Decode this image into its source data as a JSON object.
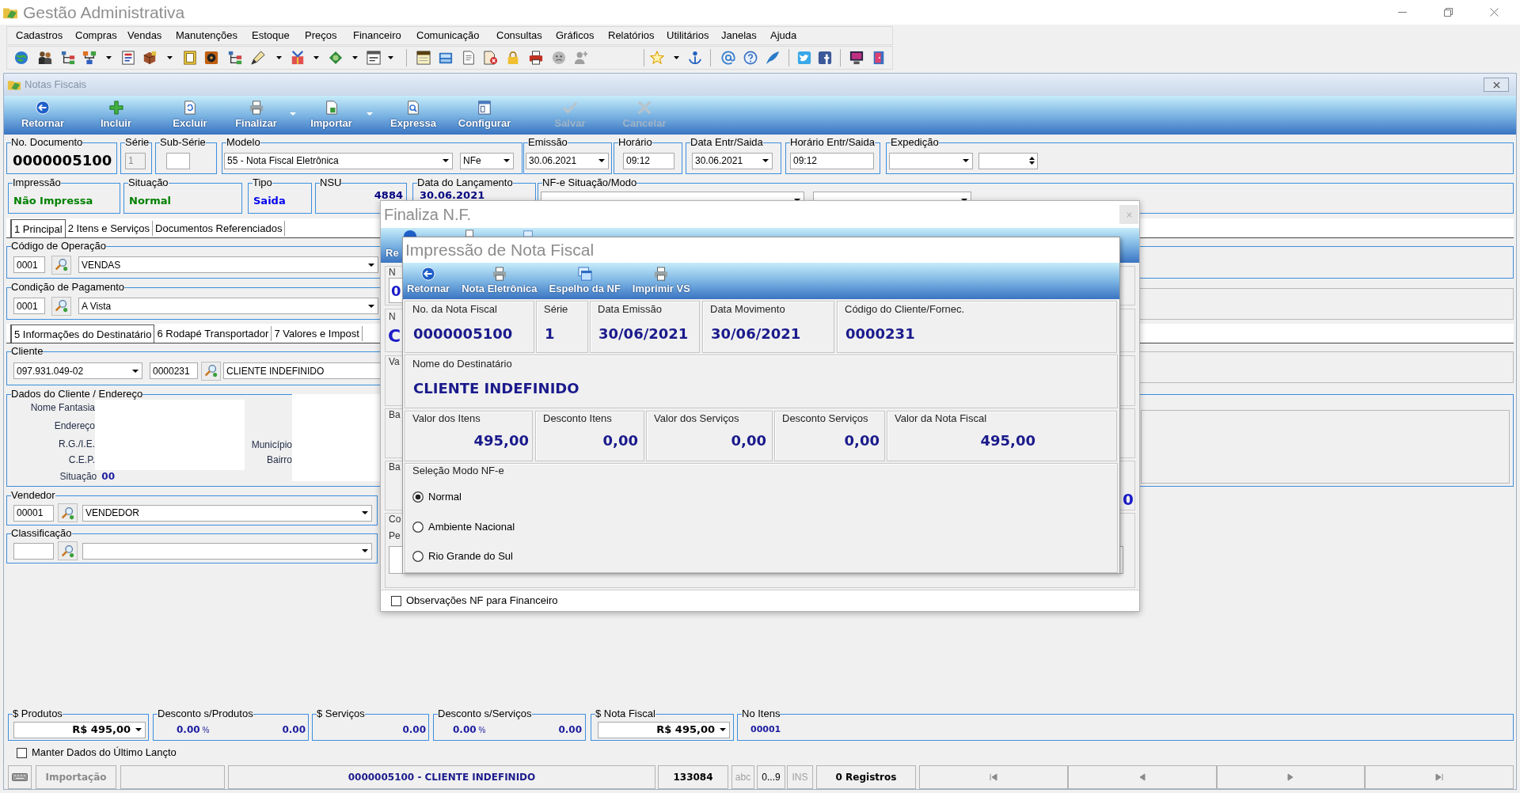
{
  "window": {
    "title": "Gestão Administrativa"
  },
  "menu": [
    "Cadastros",
    "Compras",
    "Vendas",
    "Manutenções",
    "Estoque",
    "Preços",
    "Financeiro",
    "Comunicação",
    "Consultas",
    "Gráficos",
    "Relatórios",
    "Utilitários",
    "Janelas",
    "Ajuda"
  ],
  "document_window": {
    "title": "Notas Fiscais"
  },
  "toolbar": [
    {
      "label": "Retornar",
      "disabled": false,
      "has_menu": false
    },
    {
      "label": "Incluir",
      "disabled": false,
      "has_menu": false
    },
    {
      "label": "Excluir",
      "disabled": false,
      "has_menu": false
    },
    {
      "label": "Finalizar",
      "disabled": false,
      "has_menu": true
    },
    {
      "label": "Importar",
      "disabled": false,
      "has_menu": true
    },
    {
      "label": "Expressa",
      "disabled": false,
      "has_menu": false
    },
    {
      "label": "Configurar",
      "disabled": false,
      "has_menu": false
    },
    {
      "label": "Salvar",
      "disabled": true,
      "has_menu": false
    },
    {
      "label": "Cancelar",
      "disabled": true,
      "has_menu": false
    }
  ],
  "header_rows": [
    [
      {
        "label": "No. Documento",
        "controls": [
          {
            "kind": "display",
            "value": "0000005100"
          }
        ]
      },
      {
        "label": "Série",
        "controls": [
          {
            "kind": "input",
            "value": "1",
            "disabled": true
          }
        ]
      },
      {
        "label": "Sub-Série",
        "controls": [
          {
            "kind": "input",
            "disabled": false
          }
        ]
      },
      {
        "label": "Modelo",
        "controls": [
          {
            "kind": "combo",
            "value": "55 - Nota Fiscal Eletrônica"
          },
          {
            "kind": "combo",
            "value": "NFe"
          }
        ]
      },
      {
        "label": "Emissão",
        "controls": [
          {
            "kind": "combo",
            "value": "30.06.2021"
          }
        ]
      },
      {
        "label": "Horário",
        "controls": [
          {
            "kind": "input",
            "value": "09:12",
            "disabled": false
          }
        ]
      },
      {
        "label": "Data Entr/Saida",
        "controls": [
          {
            "kind": "combo",
            "value": "30.06.2021"
          }
        ]
      },
      {
        "label": "Horário Entr/Saida",
        "controls": [
          {
            "kind": "input",
            "value": "09:12",
            "disabled": false
          }
        ]
      },
      {
        "label": "Expedição",
        "controls": [
          {
            "kind": "combo"
          },
          {
            "kind": "spin"
          }
        ]
      }
    ],
    [
      {
        "label": "Impressão",
        "controls": [
          {
            "kind": "status",
            "value": "Não Impressa",
            "color": "#008000"
          }
        ]
      },
      {
        "label": "Situação",
        "controls": [
          {
            "kind": "status",
            "value": "Normal",
            "color": "#008000"
          }
        ]
      },
      {
        "label": "Tipo",
        "controls": [
          {
            "kind": "status",
            "value": "Saida",
            "color": "#0000ee"
          }
        ]
      },
      {
        "label": "NSU",
        "controls": [
          {
            "kind": "status",
            "value": "4884",
            "color": "#000080"
          }
        ]
      },
      {
        "label": "Data do Lançamento",
        "controls": [
          {
            "kind": "status",
            "value": "30.06.2021",
            "color": "#000080"
          }
        ]
      },
      {
        "label": "NF-e Situação/Modo",
        "controls": [
          {
            "kind": "combo"
          },
          {
            "kind": "combo"
          }
        ]
      }
    ]
  ],
  "tabs_main": [
    {
      "label": "1 Principal",
      "selected": true
    },
    {
      "label": "2 Itens e Serviços",
      "selected": false
    },
    {
      "label": "Documentos Referenciados",
      "selected": false
    }
  ],
  "operation": {
    "label": "Código de Operação",
    "code": "0001",
    "value": "VENDAS"
  },
  "payment": {
    "label": "Condição de Pagamento",
    "code": "0001",
    "value": "A Vista"
  },
  "tabs_detail": [
    {
      "label": "5 Informações do Destinatário",
      "selected": true
    },
    {
      "label": "6 Rodapé Transportador",
      "selected": false
    },
    {
      "label": "7 Valores e Impost",
      "selected": false
    }
  ],
  "client": {
    "label": "Cliente",
    "document": "097.931.049-02",
    "code": "0000231",
    "name": "CLIENTE INDEFINIDO"
  },
  "client_data": {
    "label": "Dados do Cliente / Endereço",
    "fields": [
      {
        "label": "Nome Fantasia"
      },
      {
        "label": "Endereço"
      },
      {
        "label": "R.G./I.E."
      },
      {
        "label": "C.E.P."
      },
      {
        "label": "Situação",
        "value": "00"
      }
    ],
    "side_fields": [
      {
        "label": "Município"
      },
      {
        "label": "Bairro"
      }
    ]
  },
  "seller": {
    "label": "Vendedor",
    "code": "00001",
    "value": "VENDEDOR"
  },
  "classification": {
    "label": "Classificação"
  },
  "totals": [
    {
      "label": "$ Produtos",
      "kind": "combo",
      "value": "R$ 495,00"
    },
    {
      "label": "Desconto s/Produtos",
      "kind": "discount",
      "percent": "0.00",
      "unit": "%",
      "value": "0.00"
    },
    {
      "label": "$ Serviços",
      "kind": "amount",
      "value": "0.00"
    },
    {
      "label": "Desconto s/Serviços",
      "kind": "discount",
      "percent": "0.00",
      "unit": "%",
      "value": "0.00"
    },
    {
      "label": "$ Nota Fiscal",
      "kind": "combo",
      "value": "R$ 495,00"
    },
    {
      "label": "No Itens",
      "kind": "count",
      "value": "00001"
    }
  ],
  "keep_data": {
    "label": "Manter Dados do Último Lançto",
    "checked": false
  },
  "status_bar": {
    "mode": "Importação",
    "document": "0000005100 - CLIENTE INDEFINIDO",
    "code": "133084",
    "indicators": [
      {
        "label": "abc",
        "on": false
      },
      {
        "label": "0...9",
        "on": true
      },
      {
        "label": "INS",
        "on": false
      }
    ],
    "records": "0 Registros"
  },
  "finalize_dialog": {
    "title": "Finaliza N.F.",
    "toolbar": [
      "Re"
    ],
    "sections": [
      {
        "kind": "field",
        "label": "N",
        "value": "0"
      },
      {
        "kind": "text",
        "label": "N",
        "value": "C"
      },
      {
        "kind": "label",
        "label": "Va"
      },
      {
        "kind": "label",
        "label": "Ba"
      },
      {
        "kind": "amount",
        "label": "Ba",
        "value": "0"
      },
      {
        "kind": "note",
        "label": "Co",
        "note": "Pe"
      }
    ],
    "observations": {
      "label": "Observações NF para Financeiro",
      "checked": false
    }
  },
  "print_dialog": {
    "title": "Impressão de Nota Fiscal",
    "toolbar": [
      "Retornar",
      "Nota Eletrônica",
      "Espelho da NF",
      "Imprimir VS"
    ],
    "header": [
      {
        "label": "No. da Nota Fiscal",
        "value": "0000005100"
      },
      {
        "label": "Série",
        "value": "1"
      },
      {
        "label": "Data Emissão",
        "value": "30/06/2021"
      },
      {
        "label": "Data Movimento",
        "value": "30/06/2021"
      },
      {
        "label": "Código do Cliente/Fornec.",
        "value": "0000231"
      }
    ],
    "recipient": {
      "label": "Nome do Destinatário",
      "value": "CLIENTE INDEFINIDO"
    },
    "values": [
      {
        "label": "Valor dos Itens",
        "value": "495,00"
      },
      {
        "label": "Desconto Itens",
        "value": "0,00"
      },
      {
        "label": "Valor dos Serviços",
        "value": "0,00"
      },
      {
        "label": "Desconto Serviços",
        "value": "0,00"
      },
      {
        "label": "Valor da Nota Fiscal",
        "value": "495,00"
      }
    ],
    "mode": {
      "label": "Seleção Modo NF-e",
      "options": [
        {
          "label": "Normal",
          "selected": true
        },
        {
          "label": "Ambiente Nacional",
          "selected": false
        },
        {
          "label": "Rio Grande do Sul",
          "selected": false
        }
      ]
    }
  }
}
